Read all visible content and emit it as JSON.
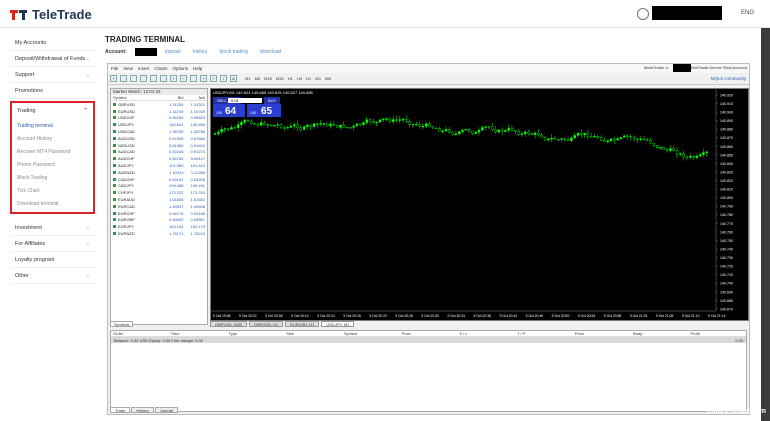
{
  "header": {
    "brand": "TeleTrade",
    "lang": "ENG"
  },
  "sidebar": {
    "top_items": [
      {
        "label": "My Accounts",
        "chev": ""
      },
      {
        "label": "Deposit/Withdrawal of Funds",
        "chev": "⌄"
      },
      {
        "label": "Support",
        "chev": "⌄"
      },
      {
        "label": "Promotions",
        "chev": ""
      }
    ],
    "trading": {
      "label": "Trading",
      "items": [
        "Trading terminal",
        "Account History",
        "Recover MT4 Password",
        "Phone Password",
        "Block Trading",
        "Tick Chart",
        "Download terminal"
      ]
    },
    "bottom_items": [
      {
        "label": "Investment",
        "chev": "⌄"
      },
      {
        "label": "For Affiliates",
        "chev": "⌄"
      },
      {
        "label": "Loyalty program",
        "chev": ""
      },
      {
        "label": "Other",
        "chev": "⌄"
      }
    ]
  },
  "page": {
    "title": "TRADING TERMINAL",
    "account_label": "Account:",
    "links": [
      "deposit",
      "history",
      "block trading",
      "download"
    ]
  },
  "terminal": {
    "menu": [
      "File",
      "View",
      "Insert",
      "Charts",
      "Options",
      "Help"
    ],
    "server_left": "MetaTrader 4:",
    "server_right": "TeleTrade-Server: Real Account",
    "mql": "MQL5 community",
    "timeframes": [
      "M1",
      "M5",
      "M15",
      "M30",
      "H1",
      "H4",
      "D1",
      "W1",
      "MN"
    ],
    "market_watch": {
      "title": "Market Watch: 12:04:34",
      "cols": [
        "Symbol",
        "Bid",
        "Ask"
      ],
      "rows": [
        [
          "GBPUSD",
          "1.31254",
          "1.31321"
        ],
        [
          "EURUSD",
          "1.16749",
          "1.16769"
        ],
        [
          "USDCHF",
          "0.95784",
          "0.95823"
        ],
        [
          "USDJPY",
          "140.641",
          "140.655"
        ],
        [
          "USDCAD",
          "1.35765",
          "1.35788"
        ],
        [
          "AUDUSD",
          "0.67646",
          "0.67666"
        ],
        [
          "NZDUSD",
          "0.61580",
          "0.61603"
        ],
        [
          "AUDCAD",
          "0.92246",
          "0.92274"
        ],
        [
          "AUDCHF",
          "0.64784",
          "0.65117"
        ],
        [
          "AUDJPY",
          "101.580",
          "101.613"
        ],
        [
          "AUDNZD",
          "1.10313",
          "1.11388"
        ],
        [
          "CADCHF",
          "0.63191",
          "0.63208"
        ],
        [
          "CADJPY",
          "109.468",
          "109.491"
        ],
        [
          "CHFJPY",
          "173.222",
          "173.253"
        ],
        [
          "EURAUD",
          "1.61506",
          "1.61563"
        ],
        [
          "EURCAD",
          "1.49537",
          "1.49558"
        ],
        [
          "EURCHF",
          "0.94175",
          "0.94188"
        ],
        [
          "EURGBP",
          "0.83540",
          "0.83851"
        ],
        [
          "EURJPY",
          "163.134",
          "163.173"
        ],
        [
          "EURNZD",
          "1.78171",
          "1.78224"
        ]
      ],
      "tab": "Symbols"
    },
    "chart": {
      "header": "USDJPY,M1  140.624 140.685 140.625 140.627 140.685",
      "sell": "SELL",
      "buy": "BUY",
      "lot": "0.01",
      "sell_price": "64",
      "buy_price": "65",
      "sell_prefix": "140",
      "buy_prefix": "140",
      "price_labels": [
        "140.920",
        "140.910",
        "140.900",
        "140.890",
        "140.880",
        "140.870",
        "140.860",
        "140.850",
        "140.840",
        "140.830",
        "140.820",
        "140.810",
        "140.800",
        "140.790",
        "140.780",
        "140.770",
        "140.760",
        "140.750",
        "140.740",
        "140.730",
        "140.720",
        "140.710",
        "140.700",
        "140.690",
        "140.680",
        "140.670"
      ],
      "time_labels": [
        "9 Oct 19:58",
        "9 Oct 20:02",
        "9 Oct 20:06",
        "9 Oct 20:10",
        "9 Oct 20:14",
        "9 Oct 20:18",
        "9 Oct 20:22",
        "9 Oct 20:26",
        "9 Oct 20:30",
        "9 Oct 20:34",
        "9 Oct 20:38",
        "9 Oct 20:42",
        "9 Oct 20:46",
        "9 Oct 20:50",
        "9 Oct 20:54",
        "9 Oct 20:58",
        "9 Oct 21:02",
        "9 Oct 21:06",
        "9 Oct 21:10",
        "9 Oct 21:14"
      ],
      "tabs": [
        "GBPUSD, M30",
        "GBPUSD, H1",
        "EURUSD, H1",
        "USDJPY, M1"
      ]
    },
    "panel": {
      "cols": [
        "Order",
        "Time",
        "Type",
        "Size",
        "Symbol",
        "Price",
        "S / L",
        "T / P",
        "Price",
        "Swap",
        "Profit"
      ],
      "balance": "Balance: 0.00 USD  Equity: 0.00  Free margin: 0.00",
      "balance_val": "0.00",
      "tabs": [
        "Trade",
        "History",
        "Journal"
      ]
    }
  },
  "watermark": "binary-smart.com"
}
